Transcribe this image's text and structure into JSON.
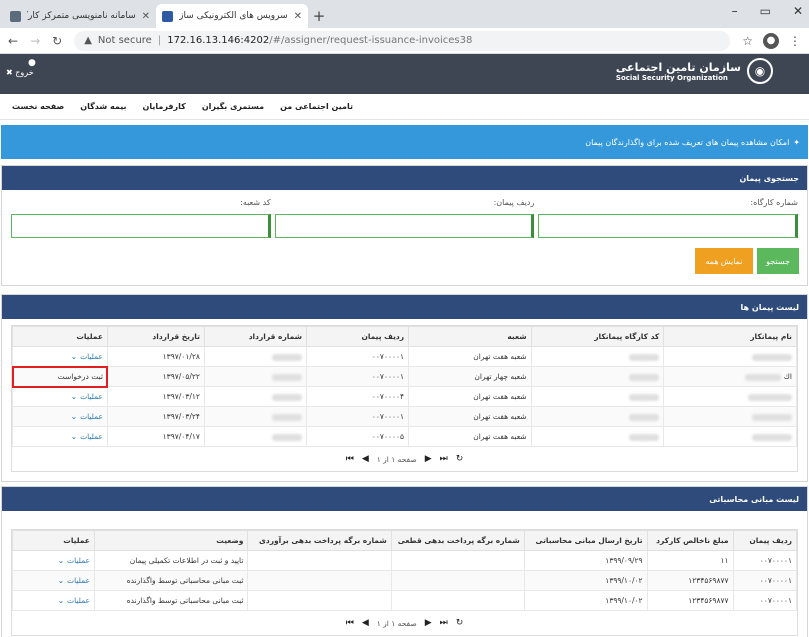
{
  "browser": {
    "tabs": [
      {
        "title": "سامانه نامنویسی متمرکز کارگاه و ...",
        "active": false
      },
      {
        "title": "سرویس های الکترونیکی سازمان تا...",
        "active": true
      }
    ],
    "new_tab": "+",
    "window_controls": [
      "–",
      "▭",
      "✕"
    ],
    "security_label": "Not secure",
    "url_host": "172.16.13.146:4202",
    "url_path": "/#/assigner/request-issuance-invoices38"
  },
  "header": {
    "org_name_fa": "سازمان تامین اجتماعی",
    "org_name_en": "Social Security Organization",
    "logout_label": "خروج"
  },
  "menu": {
    "items": [
      "صفحه نخست",
      "بیمه شدگان",
      "کارفرمایان",
      "مستمری بگیران",
      "تامین اجتماعی من"
    ]
  },
  "info": {
    "text": "امکان مشاهده پیمان های تعریف شده برای واگذارندگان پیمان"
  },
  "search": {
    "title": "جستجوی پیمان",
    "fields": [
      {
        "label": "شماره کارگاه:",
        "value": ""
      },
      {
        "label": "ردیف پیمان:",
        "value": ""
      },
      {
        "label": "کد شعبه:",
        "value": ""
      }
    ],
    "search_label": "جستجو",
    "show_all_label": "نمایش همه"
  },
  "contracts": {
    "title": "لیست پیمان ها",
    "headers": [
      "نام پیمانکار",
      "کد کارگاه پیمانکار",
      "شعبه",
      "ردیف پیمان",
      "شماره قرارداد",
      "تاریخ قرارداد",
      "عملیات"
    ],
    "rows": [
      {
        "contractor": "",
        "code": "",
        "branch": "شعبه هفت تهران",
        "row": "۰۰۷۰۰۰۰۱",
        "number": "",
        "date": "۱۳۹۷/۰۱/۲۸",
        "op": "عملیات",
        "highlight": false
      },
      {
        "contractor": "اك",
        "code": "",
        "branch": "شعبه چهار تهران",
        "row": "۰۰۷۰۰۰۰۱",
        "number": "",
        "date": "۱۳۹۷/۰۵/۲۲",
        "op": "ثبت درخواست",
        "highlight": true
      },
      {
        "contractor": "",
        "code": "",
        "branch": "شعبه هفت تهران",
        "row": "۰۰۷۰۰۰۰۴",
        "number": "",
        "date": "۱۳۹۷/۰۳/۱۲",
        "op": "عملیات",
        "highlight": false
      },
      {
        "contractor": "",
        "code": "",
        "branch": "شعبه هفت تهران",
        "row": "۰۰۷۰۰۰۰۱",
        "number": "",
        "date": "۱۳۹۷/۰۳/۲۴",
        "op": "عملیات",
        "highlight": false
      },
      {
        "contractor": "",
        "code": "",
        "branch": "شعبه هفت تهران",
        "row": "۰۰۷۰۰۰۰۵",
        "number": "",
        "date": "۱۳۹۷/۰۴/۱۷",
        "op": "عملیات",
        "highlight": false
      }
    ],
    "pager": {
      "info": "صفحه ۱ از ۱"
    }
  },
  "invoices": {
    "title": "لیست مبانی محاسباتی",
    "headers": [
      "ردیف پیمان",
      "مبلغ ناخالص کارکرد",
      "تاریخ ارسال مبانی محاسباتی",
      "شماره برگه پرداخت بدهی قطعی",
      "شماره برگه پرداخت بدهی برآوردی",
      "وضعیت",
      "عملیات"
    ],
    "rows": [
      {
        "row": "۰۰۷۰۰۰۰۱",
        "amount": "۱۱",
        "date": "۱۳۹۹/۰۹/۲۹",
        "final": "",
        "estimate": "",
        "status": "تایید و ثبت در اطلاعات تکمیلی پیمان",
        "op": "عملیات"
      },
      {
        "row": "۰۰۷۰۰۰۰۱",
        "amount": "۱۲۳۴۵۶۹۸۷۷",
        "date": "۱۳۹۹/۱۰/۰۲",
        "final": "",
        "estimate": "",
        "status": "ثبت مبانی محاسباتی توسط واگذارنده",
        "op": "عملیات"
      },
      {
        "row": "۰۰۷۰۰۰۰۱",
        "amount": "۱۲۳۴۵۶۹۸۷۷",
        "date": "۱۳۹۹/۱۰/۰۲",
        "final": "",
        "estimate": "",
        "status": "ثبت مبانی محاسباتی توسط واگذارنده",
        "op": "عملیات"
      }
    ],
    "pager": {
      "info": "صفحه ۱ از ۱"
    }
  }
}
